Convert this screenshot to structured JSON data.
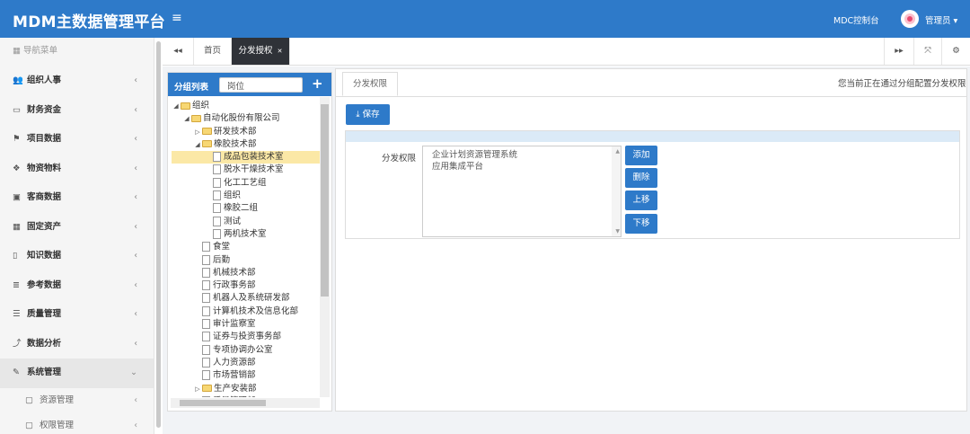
{
  "app": {
    "title": "MDM主数据管理平台",
    "menu_toggle": "≡",
    "console": "MDC控制台",
    "user": "管理员 ▾"
  },
  "sidebar": {
    "header": "导航菜单",
    "header_icon": "grid-icon",
    "items": [
      {
        "label": "组织人事",
        "icon": "users-icon"
      },
      {
        "label": "财务资金",
        "icon": "card-icon"
      },
      {
        "label": "项目数据",
        "icon": "sitemap-icon"
      },
      {
        "label": "物资物料",
        "icon": "cubes-icon"
      },
      {
        "label": "客商数据",
        "icon": "briefcase-icon"
      },
      {
        "label": "固定资产",
        "icon": "building-icon"
      },
      {
        "label": "知识数据",
        "icon": "book-icon"
      },
      {
        "label": "参考数据",
        "icon": "list-icon"
      },
      {
        "label": "质量管理",
        "icon": "tasks-icon"
      },
      {
        "label": "数据分析",
        "icon": "chart-icon"
      },
      {
        "label": "系统管理",
        "icon": "wrench-icon"
      }
    ],
    "subitems": [
      {
        "label": "资源管理",
        "icon": "folder-icon"
      },
      {
        "label": "权限管理",
        "icon": "folder-icon"
      }
    ]
  },
  "tabs": {
    "back": "◂◂",
    "home": "首页",
    "active": "分发授权",
    "close": "✕",
    "forward": "▸▸",
    "expand": "⤧",
    "gear": "⚙"
  },
  "left_panel": {
    "title": "分组列表",
    "search_value": "岗位",
    "add": "+",
    "tree": [
      {
        "text": "组织",
        "indent": 0,
        "type": "folder",
        "arrow": "◢"
      },
      {
        "text": "自动化股份有限公司",
        "indent": 1,
        "type": "folder",
        "arrow": "◢"
      },
      {
        "text": "研发技术部",
        "indent": 2,
        "type": "folder",
        "arrow": "▷"
      },
      {
        "text": "橡胶技术部",
        "indent": 2,
        "type": "folder",
        "arrow": "◢"
      },
      {
        "text": "成品包装技术室",
        "indent": 3,
        "type": "doc",
        "arrow": ""
      },
      {
        "text": "脱水干燥技术室",
        "indent": 3,
        "type": "doc",
        "arrow": ""
      },
      {
        "text": "化工工艺组",
        "indent": 3,
        "type": "doc",
        "arrow": ""
      },
      {
        "text": "组织",
        "indent": 3,
        "type": "doc",
        "arrow": ""
      },
      {
        "text": "橡胶二组",
        "indent": 3,
        "type": "doc",
        "arrow": ""
      },
      {
        "text": "测试",
        "indent": 3,
        "type": "doc",
        "arrow": ""
      },
      {
        "text": "两机技术室",
        "indent": 3,
        "type": "doc",
        "arrow": ""
      },
      {
        "text": "食堂",
        "indent": 2,
        "type": "doc",
        "arrow": ""
      },
      {
        "text": "后勤",
        "indent": 2,
        "type": "doc",
        "arrow": ""
      },
      {
        "text": "机械技术部",
        "indent": 2,
        "type": "doc",
        "arrow": ""
      },
      {
        "text": "行政事务部",
        "indent": 2,
        "type": "doc",
        "arrow": ""
      },
      {
        "text": "机器人及系统研发部",
        "indent": 2,
        "type": "doc",
        "arrow": ""
      },
      {
        "text": "计算机技术及信息化部",
        "indent": 2,
        "type": "doc",
        "arrow": ""
      },
      {
        "text": "审计监察室",
        "indent": 2,
        "type": "doc",
        "arrow": ""
      },
      {
        "text": "证券与投资事务部",
        "indent": 2,
        "type": "doc",
        "arrow": ""
      },
      {
        "text": "专项协调办公室",
        "indent": 2,
        "type": "doc",
        "arrow": ""
      },
      {
        "text": "人力资源部",
        "indent": 2,
        "type": "doc",
        "arrow": ""
      },
      {
        "text": "市场营销部",
        "indent": 2,
        "type": "doc",
        "arrow": ""
      },
      {
        "text": "生产安装部",
        "indent": 2,
        "type": "folder",
        "arrow": "▷"
      },
      {
        "text": "质量管理部",
        "indent": 2,
        "type": "doc",
        "arrow": ""
      }
    ]
  },
  "right_panel": {
    "tab": "分发权限",
    "notice": "您当前正在通过分组配置分发权限",
    "save": "⤓ 保存",
    "field_label": "分发权限",
    "list": [
      "企业计划资源管理系统",
      "应用集成平台"
    ],
    "buttons": {
      "add": "添加",
      "delete": "删除",
      "up": "上移",
      "down": "下移"
    }
  },
  "colors": {
    "primary": "#2e7ac9",
    "active_tab": "#2f3238",
    "selected_row": "#fbe8a6"
  }
}
